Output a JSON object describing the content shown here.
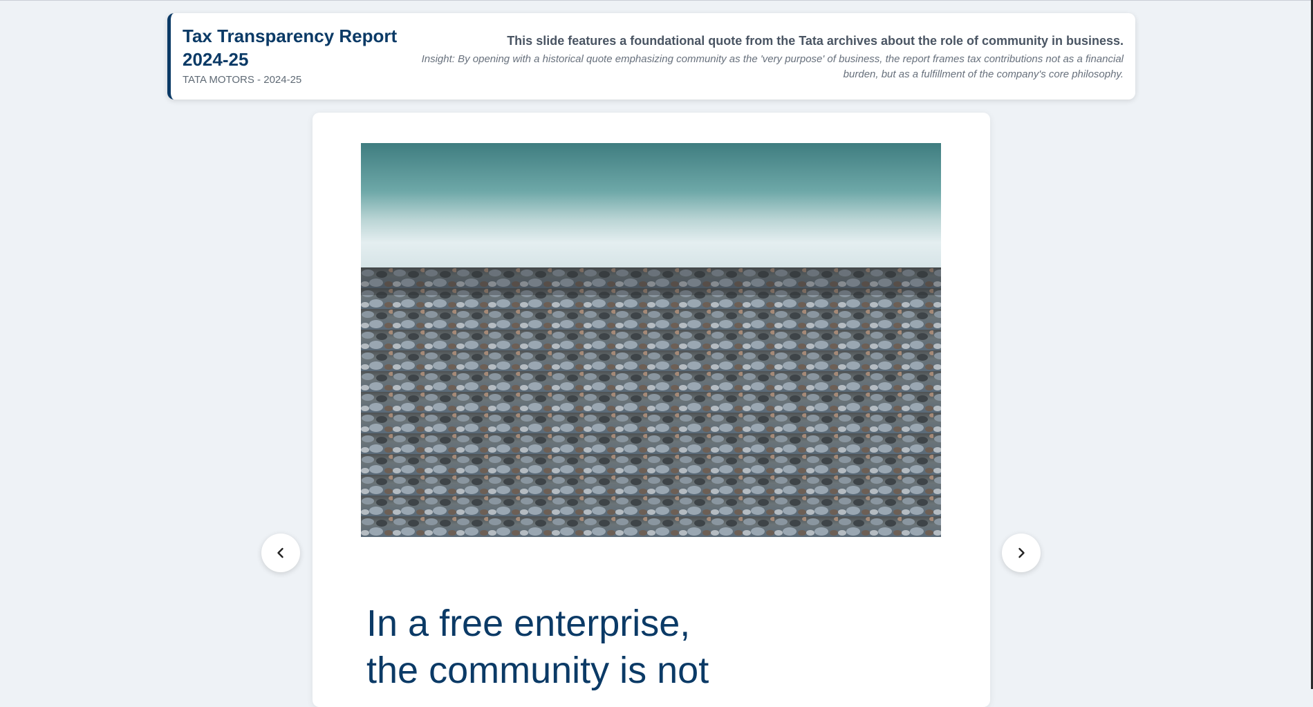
{
  "header": {
    "title": "Tax Transparency Report 2024-25",
    "subtitle": "TATA MOTORS - 2024-25",
    "summary": "This slide features a foundational quote from the Tata archives about the role of community in business.",
    "insight": "Insight: By opening with a historical quote emphasizing community as the 'very purpose' of business, the report frames tax contributions not as a financial burden, but as a fulfillment of the company's core philosophy."
  },
  "slide": {
    "image_icon": "pebble-beach-photo",
    "quote_line1": "In a free enterprise,",
    "quote_line2": "the community is not"
  },
  "navigation": {
    "prev_icon": "chevron-left-icon",
    "next_icon": "chevron-right-icon"
  },
  "colors": {
    "brand": "#0b3a66",
    "background": "#eef2f6"
  }
}
